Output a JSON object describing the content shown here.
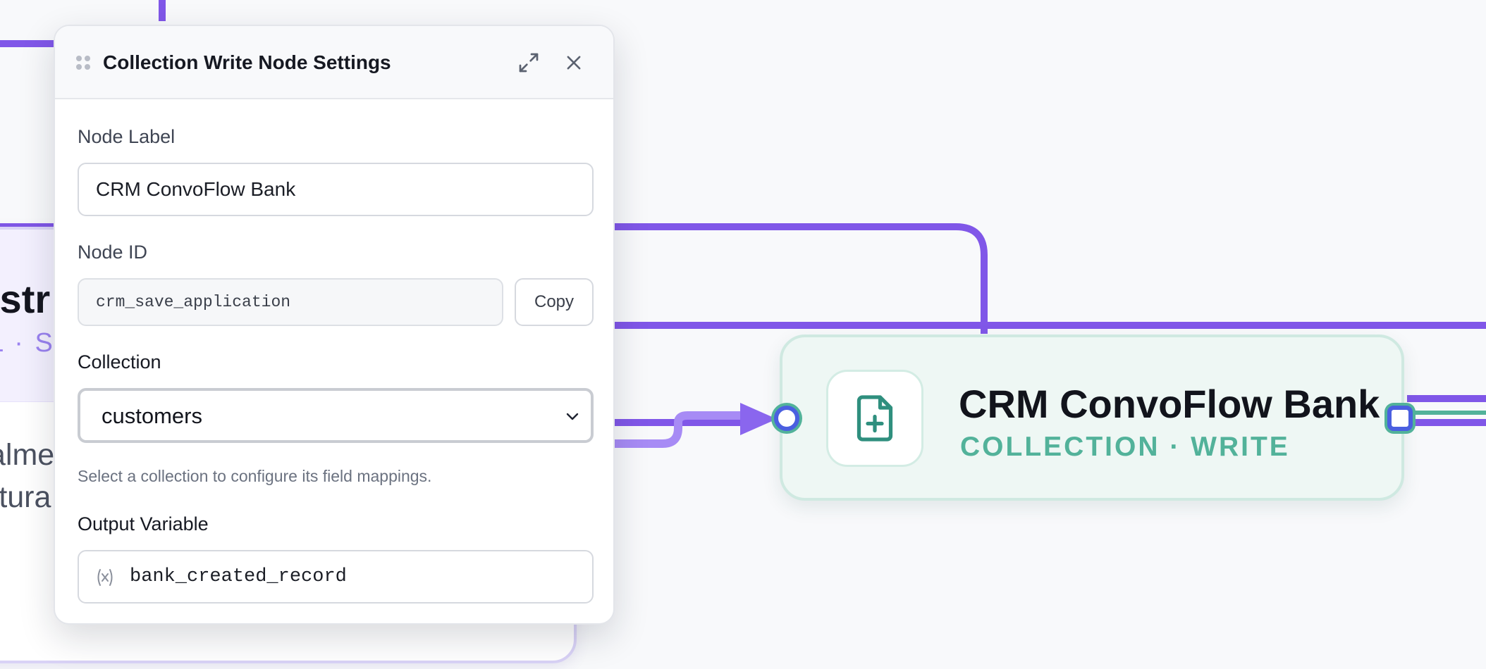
{
  "canvas": {
    "background_node": {
      "title_fragment": "istr",
      "subtitle_fragment": "L · S",
      "body_line_1": "alme",
      "body_line_2": "rtura"
    },
    "crm_node": {
      "title": "CRM ConvoFlow Bank",
      "subtitle": "COLLECTION · WRITE",
      "icon": "file-plus-icon"
    },
    "colors": {
      "edge": "#8057e8",
      "node_accent": "#52b29a",
      "handle": "#4a5fe0"
    }
  },
  "panel": {
    "title": "Collection Write Node Settings",
    "node_label": {
      "label": "Node Label",
      "value": "CRM ConvoFlow Bank"
    },
    "node_id": {
      "label": "Node ID",
      "value": "crm_save_application",
      "copy_label": "Copy"
    },
    "collection": {
      "label": "Collection",
      "selected": "customers",
      "helper": "Select a collection to configure its field mappings."
    },
    "output_variable": {
      "label": "Output Variable",
      "value": "bank_created_record",
      "icon": "variable-icon"
    }
  }
}
